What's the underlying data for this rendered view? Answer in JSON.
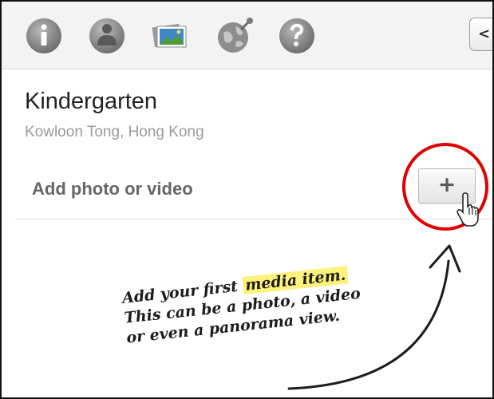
{
  "toolbar": {
    "icons": [
      "info-icon",
      "street-view-icon",
      "photos-icon",
      "globe-icon",
      "help-icon"
    ],
    "collapse_glyph": "<"
  },
  "place": {
    "title": "Kindergarten",
    "subtitle": "Kowloon Tong, Hong Kong"
  },
  "media": {
    "add_label": "Add photo or video",
    "add_button_glyph": "+"
  },
  "callout": {
    "line1_before": "Add your first ",
    "line1_highlight": "media item.",
    "line2": "This can be a photo, a video",
    "line3": "or even a panorama view."
  },
  "colors": {
    "highlight_circle": "#e00000",
    "callout_highlight": "#fff27a",
    "toolbar_icon_gray": "#8a8a8a"
  }
}
